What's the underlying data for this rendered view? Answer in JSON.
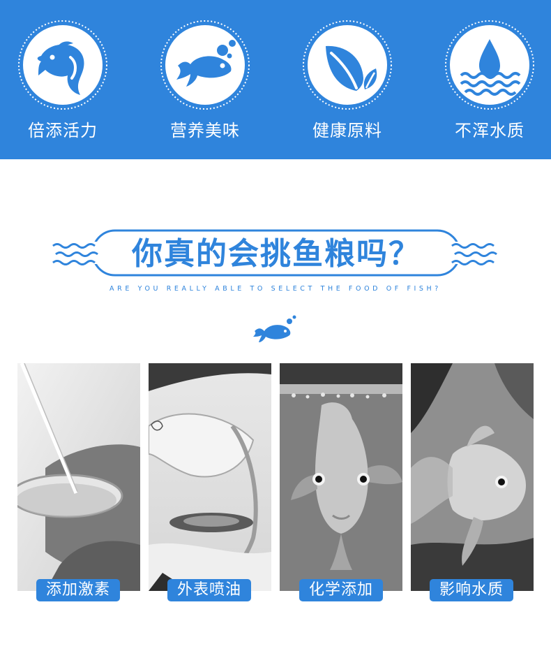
{
  "colors": {
    "brand_blue": "#2f84dc",
    "background": "#ffffff"
  },
  "features": [
    {
      "label": "倍添活力",
      "icon": "fish-icon"
    },
    {
      "label": "营养美味",
      "icon": "fish-bubbles-icon"
    },
    {
      "label": "健康原料",
      "icon": "leaf-icon"
    },
    {
      "label": "不浑水质",
      "icon": "water-drop-icon"
    }
  ],
  "heading": {
    "title": "你真的会挑鱼粮吗？",
    "subtitle": "ARE YOU REALLY ABLE TO SELECT THE FOOD OF FISH?"
  },
  "cards": [
    {
      "tag": "添加激素",
      "photo": "lab-pipette-petri-dish-photo"
    },
    {
      "tag": "外表喷油",
      "photo": "oil-pouring-photo"
    },
    {
      "tag": "化学添加",
      "photo": "parrot-fish-photo"
    },
    {
      "tag": "影响水质",
      "photo": "goldfish-photo"
    }
  ]
}
